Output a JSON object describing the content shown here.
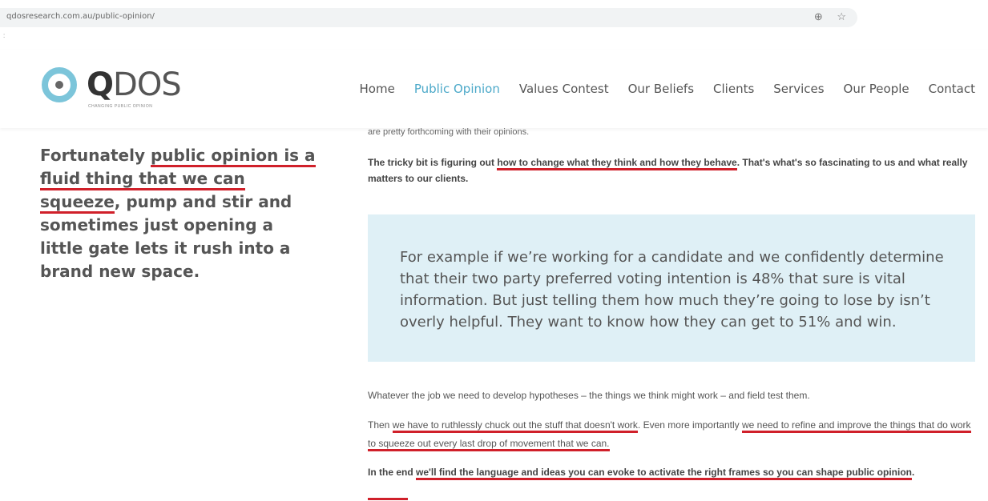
{
  "browser": {
    "url": "qdosresearch.com.au/public-opinion/",
    "zoom_icon": "⊕",
    "star_icon": "☆",
    "tick": ":"
  },
  "logo": {
    "name_bold": "Q",
    "name_light": "DOS",
    "tagline": "CHANGING PUBLIC OPINION"
  },
  "nav": {
    "items": [
      "Home",
      "Public Opinion",
      "Values Contest",
      "Our Beliefs",
      "Clients",
      "Services",
      "Our People",
      "Contact"
    ],
    "active": "Public Opinion",
    "active_color": "#4ca9c9"
  },
  "pullquote": {
    "a": "Fortunately ",
    "b": "public opinion is a",
    "c": "fluid thing that we can squeeze",
    "d": ", pump and stir and sometimes just opening a little gate lets it rush into a brand new space."
  },
  "content": {
    "cut_line": "are pretty forthcoming with their opinions.",
    "p1_a": "The tricky bit is figuring out ",
    "p1_b": "how to change what they think and how they behave",
    "p1_c": ". That's what's so fascinating to us and what really matters to our clients.",
    "quote": "For example if we’re working for a candidate and we confidently determine that their two party preferred voting intention is 48% that sure is vital information. But just telling them how much they’re going to lose by isn’t overly helpful. They want to know how they can get to 51% and win.",
    "p2": "Whatever the job we need to develop hypotheses – the things we think might work – and field test them.",
    "p3_a": "Then ",
    "p3_b": "we have to ruthlessly chuck out the stuff that doesn't work",
    "p3_c": ". Even more importantly ",
    "p3_d": "we need to refine and improve the things that do work to squeeze out every last drop of movement that we can.",
    "p4_a": "In the end ",
    "p4_b": "we'll find the language and ideas you can evoke to activate the right frames so you can shape public opinion",
    "p4_c": "."
  },
  "colors": {
    "accent": "#4ca9c9",
    "underline": "#d0202a",
    "quote_bg": "#dff0f6"
  }
}
